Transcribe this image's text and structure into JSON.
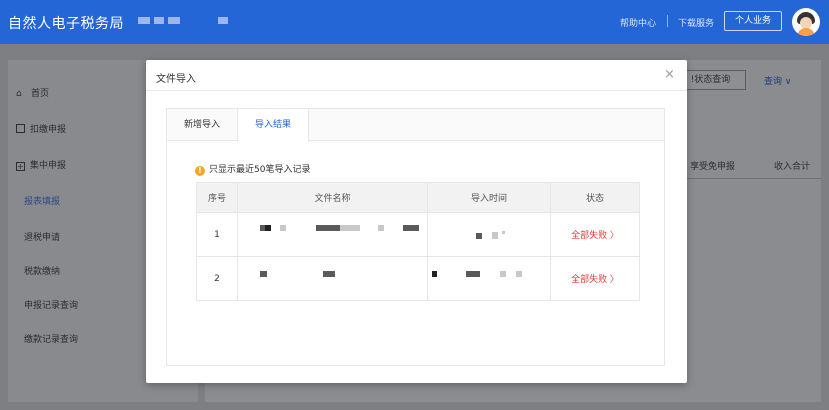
{
  "header": {
    "app_title": "自然人电子税务局",
    "help_link": "帮助中心",
    "download_link": "下载服务",
    "personal_business_button": "个人业务"
  },
  "sidebar": {
    "items": [
      {
        "label": "首页",
        "icon": "home-icon"
      },
      {
        "label": "扣缴申报",
        "icon": "form-icon"
      },
      {
        "label": "集中申报",
        "icon": "plus-square-icon"
      }
    ],
    "sub_items": [
      {
        "label": "报表填报"
      },
      {
        "label": "退税申请"
      },
      {
        "label": "税款缴纳"
      },
      {
        "label": "申报记录查询"
      },
      {
        "label": "缴款记录查询"
      }
    ]
  },
  "background": {
    "status_query_button": "!状态查询",
    "query_dropdown": "查询 ∨",
    "col_exempt": "享受免申报",
    "col_income": "收入合计"
  },
  "modal": {
    "title": "文件导入",
    "close": "×",
    "tabs": [
      {
        "label": "新增导入",
        "active": false
      },
      {
        "label": "导入结果",
        "active": true
      }
    ],
    "notice": "只显示最近50笔导入记录",
    "table": {
      "headers": [
        "序号",
        "文件名称",
        "导入时间",
        "状态"
      ],
      "rows": [
        {
          "index": "1",
          "status": "全部失败 〉"
        },
        {
          "index": "2",
          "status": "全部失败 〉"
        }
      ]
    }
  },
  "colors": {
    "header_bg": "#2566d6",
    "accent": "#2566d6",
    "fail": "#e03b3b",
    "warning": "#f5a623"
  }
}
